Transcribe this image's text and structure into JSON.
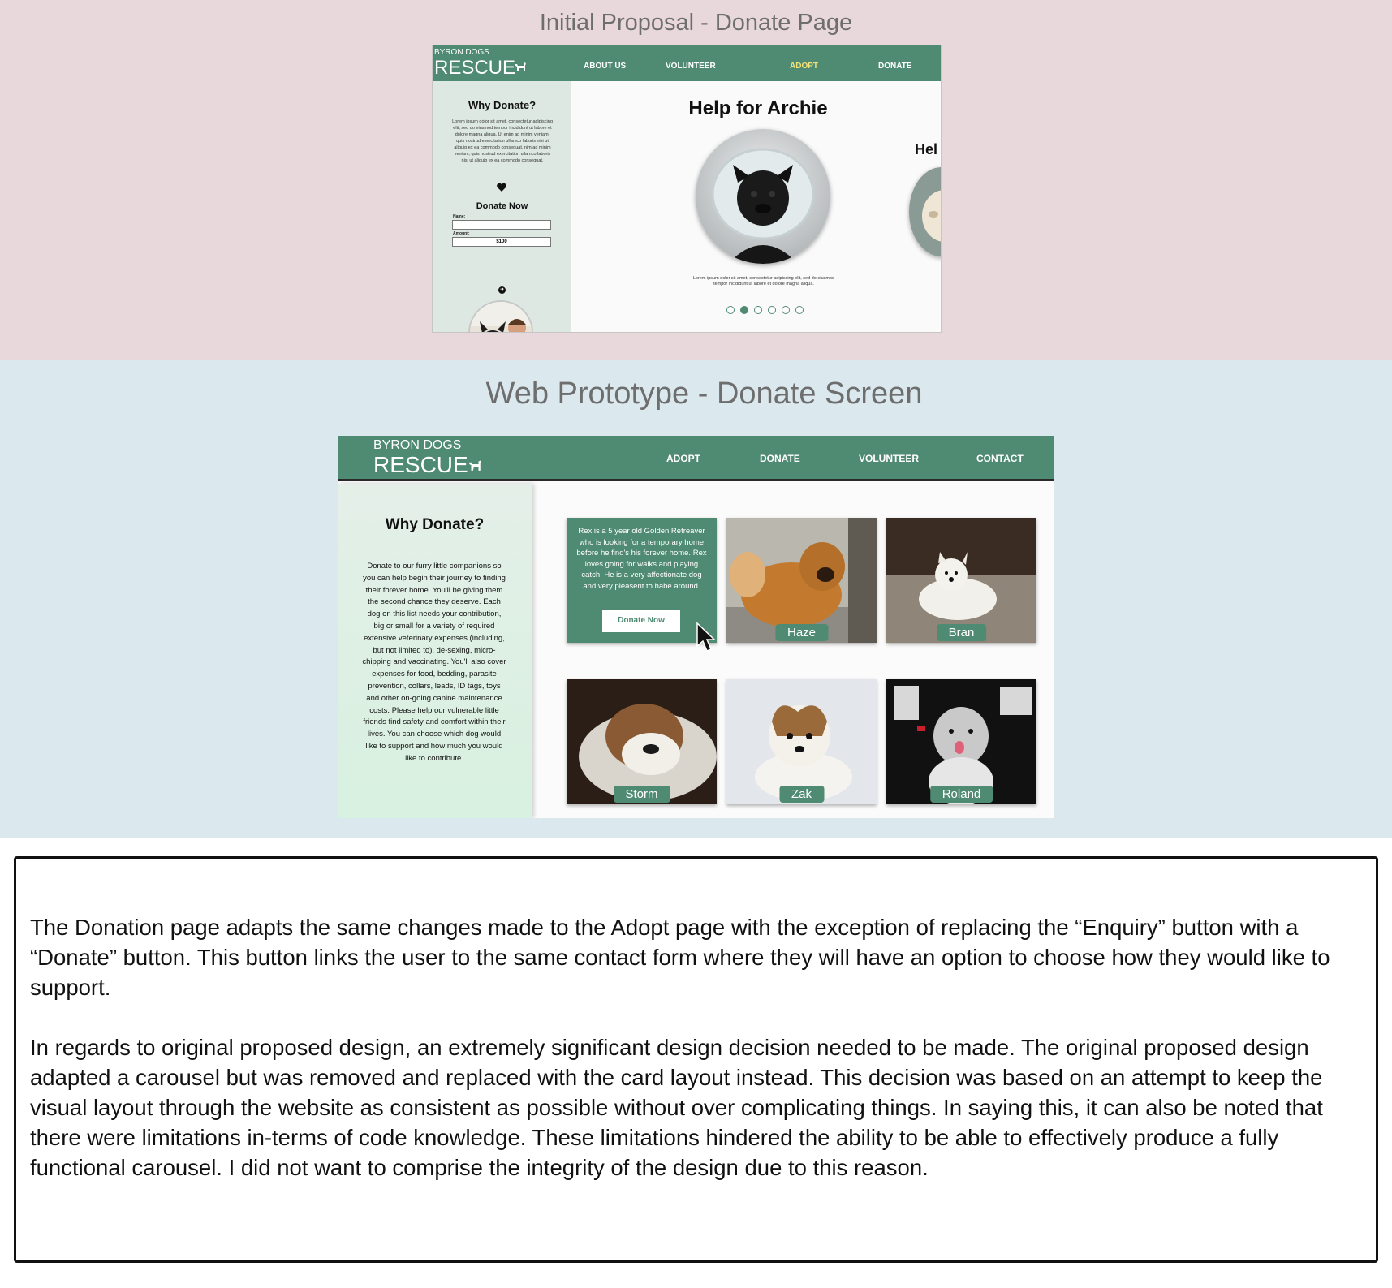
{
  "colors": {
    "accent": "#4f8a72",
    "active_nav": "#f2e27a",
    "proposal_bg": "#e8d8db",
    "prototype_bg": "#dbe9ef"
  },
  "proposal": {
    "heading": "Initial Proposal - Donate Page",
    "brand_small": "BYRON DOGS",
    "brand_big": "RESCUE",
    "nav": [
      "ABOUT US",
      "VOLUNTEER",
      "ADOPT",
      "DONATE"
    ],
    "active_nav": "ADOPT",
    "sidebar": {
      "title": "Why Donate?",
      "lorem": "Lorem ipsum dolor sit amet, consectetur adipiscing elit, sed do eiusmod tempor incididunt ut labore et dolore magna aliqua. Ut enim ad minim veniam, quis nostrud exercitation ullamco laboris nisi ut aliquip ex ea commodo consequat. nim ad minim veniam, quis nostrud exercitation ullamco laboris nisi ut aliquip ex ea commodo consequat.",
      "donate_heading": "Donate Now",
      "name_label": "Name:",
      "name_value": "",
      "amount_label": "Amount:",
      "amount_value": "$100"
    },
    "main": {
      "title": "Help for Archie",
      "peek_title": "Hel",
      "caption": "Lorem ipsum dolor sit amet, consectetur adipiscing elit, sed do eiusmod tempor incididunt ut labore et dolore magna aliqua.",
      "carousel_dots": 6,
      "active_dot": 2
    }
  },
  "prototype": {
    "heading": "Web Prototype - Donate Screen",
    "brand_small": "BYRON DOGS",
    "brand_big": "RESCUE",
    "nav": [
      "ADOPT",
      "DONATE",
      "VOLUNTEER",
      "CONTACT"
    ],
    "sidebar": {
      "title": "Why Donate?",
      "body": "Donate to our furry little companions so you can help begin their journey to finding their forever home. You'll be giving them the second chance they deserve. Each dog on this list needs your contribution, big or small for a variety of required extensive veterinary expenses (including, but not limited to), de-sexing, micro-chipping and vaccinating. You'll also cover expenses for food, bedding, parasite prevention, collars, leads, ID tags, toys and other on-going canine maintenance costs. Please help our vulnerable little friends find safety and comfort within their lives. You can choose which dog would like to support and how much you would like to contribute."
    },
    "info_card": {
      "text": "Rex is a 5 year old Golden Retreaver who is looking for a temporary home before he find's his forever home. Rex loves going for walks and playing catch. He is a very affectionate dog and very pleasent to habe around.",
      "button": "Donate Now"
    },
    "dogs": [
      "Haze",
      "Bran",
      "Storm",
      "Zak",
      "Roland"
    ]
  },
  "notes": {
    "paragraph1": "The Donation page adapts the same changes made to the Adopt page with the exception of replacing the “Enquiry” button with a “Donate” button. This button links the user to the same contact form where they will have an option to choose how they would like to support.",
    "paragraph2": "In regards to original proposed design, an extremely significant design decision needed to be made. The original proposed design adapted a carousel but was removed and replaced with the card layout instead. This decision was based on an attempt to keep the visual layout through the website as consistent as possible without over complicating things. In saying this, it can also be noted that there were limitations in-terms of code knowledge. These limitations hindered the ability to be able to effectively produce a fully functional carousel. I did not want to comprise the integrity of the design due to this reason."
  }
}
